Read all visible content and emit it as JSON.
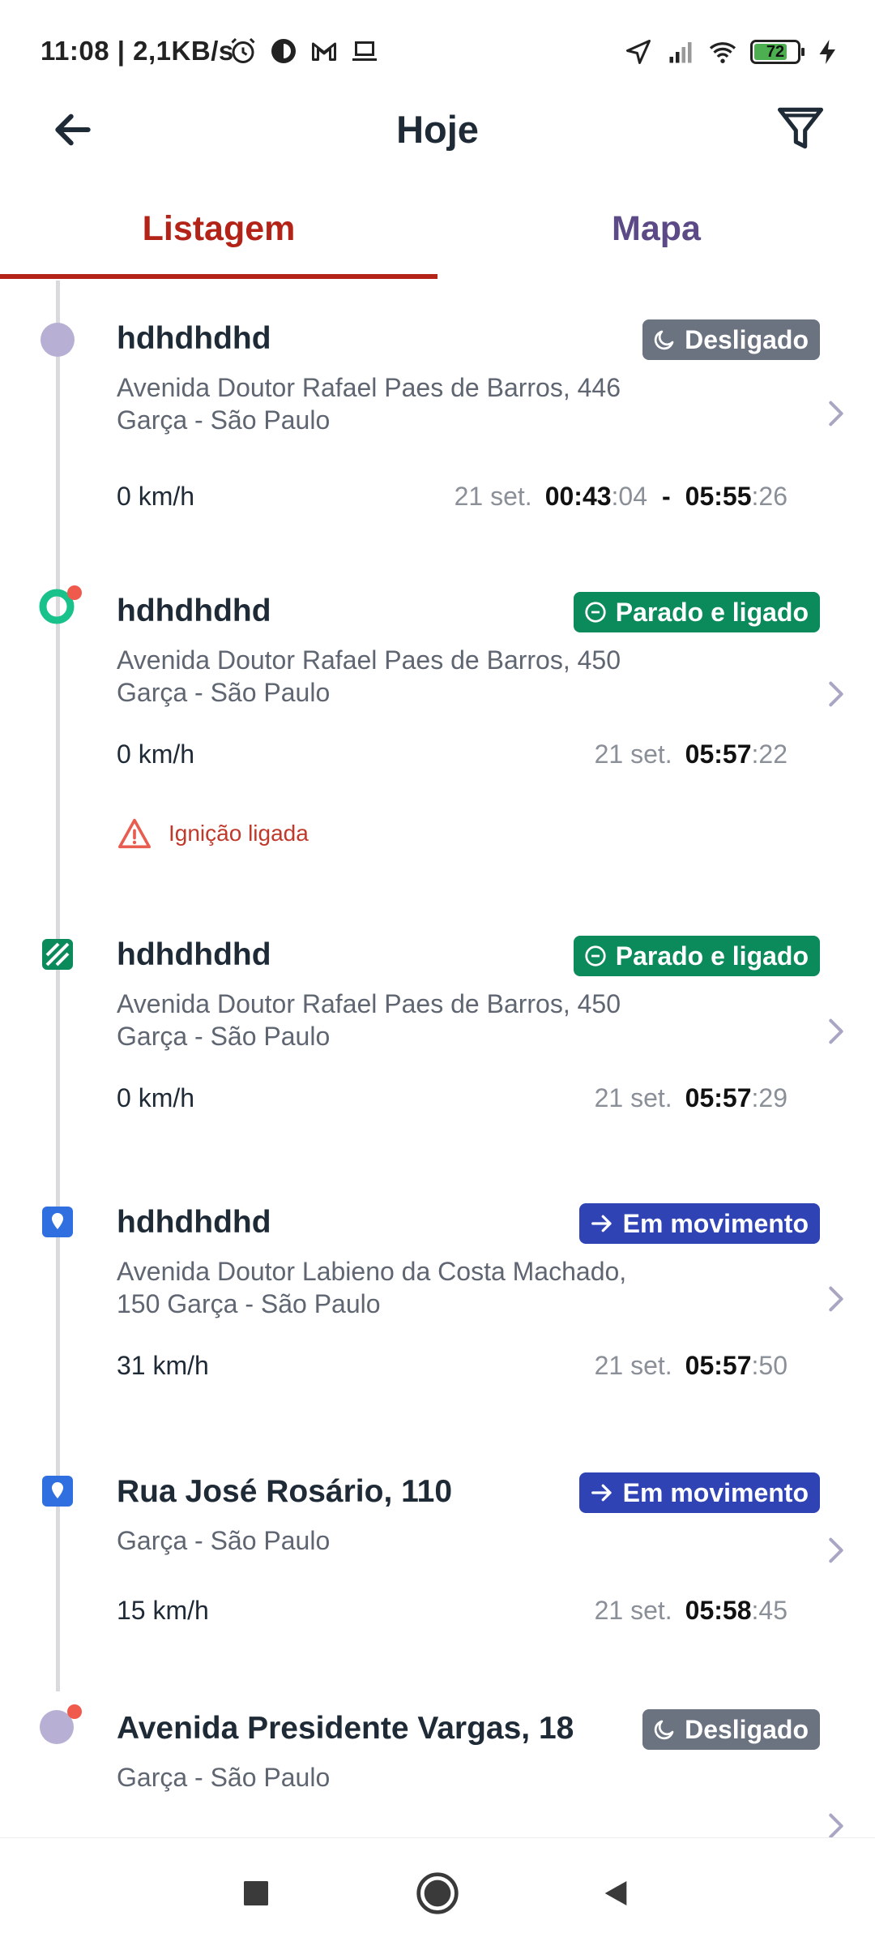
{
  "status_bar": {
    "time_speed": "11:08 | 2,1KB/s",
    "battery_level": "72",
    "icons_left": [
      "alarm-icon",
      "app-circle-icon",
      "gmail-icon",
      "laptop-icon"
    ],
    "icons_right": [
      "location-arrow-icon",
      "signal-icon",
      "wifi-icon",
      "battery-icon",
      "charging-icon"
    ]
  },
  "header": {
    "title": "Hoje"
  },
  "tabs": [
    {
      "label": "Listagem",
      "active": true
    },
    {
      "label": "Mapa",
      "active": false
    }
  ],
  "colors": {
    "accent_red": "#b42318",
    "tab_inactive": "#5b4a86",
    "badge_off": "#6b7280",
    "badge_stopped": "#0b8a5b",
    "badge_moving": "#2f43b5",
    "warning": "#c0392b"
  },
  "events": [
    {
      "name": "hdhdhdhd",
      "status": "Desligado",
      "status_icon": "moon-icon",
      "address": "Avenida Doutor Rafael Paes de Barros, 446 Garça - São Paulo",
      "speed": "0 km/h",
      "date": "21 set.",
      "start_hm": "00:43",
      "start_sec": ":04",
      "separator": "-",
      "end_hm": "05:55",
      "end_sec": ":26"
    },
    {
      "name": "hdhdhdhd",
      "status": "Parado e ligado",
      "status_icon": "minus-circle-icon",
      "address": "Avenida Doutor Rafael Paes de Barros, 450 Garça - São Paulo",
      "speed": "0 km/h",
      "date": "21 set.",
      "hm": "05:57",
      "sec": ":22",
      "warning": "Ignição ligada"
    },
    {
      "name": "hdhdhdhd",
      "status": "Parado e ligado",
      "status_icon": "minus-circle-icon",
      "address": "Avenida Doutor Rafael Paes de Barros, 450 Garça - São Paulo",
      "speed": "0 km/h",
      "date": "21 set.",
      "hm": "05:57",
      "sec": ":29"
    },
    {
      "name": "hdhdhdhd",
      "status": "Em movimento",
      "status_icon": "arrow-right-icon",
      "address": "Avenida Doutor Labieno da Costa Machado, 150 Garça - São Paulo",
      "speed": "31 km/h",
      "date": "21 set.",
      "hm": "05:57",
      "sec": ":50"
    },
    {
      "name": "Rua José Rosário, 110",
      "status": "Em movimento",
      "status_icon": "arrow-right-icon",
      "address": "Garça - São Paulo",
      "speed": "15 km/h",
      "date": "21 set.",
      "hm": "05:58",
      "sec": ":45"
    },
    {
      "name": "Avenida Presidente Vargas, 18",
      "status": "Desligado",
      "status_icon": "moon-icon",
      "address": "Garça - São Paulo"
    }
  ],
  "navbar": {
    "buttons": [
      "recents-icon",
      "home-icon",
      "back-icon"
    ]
  }
}
